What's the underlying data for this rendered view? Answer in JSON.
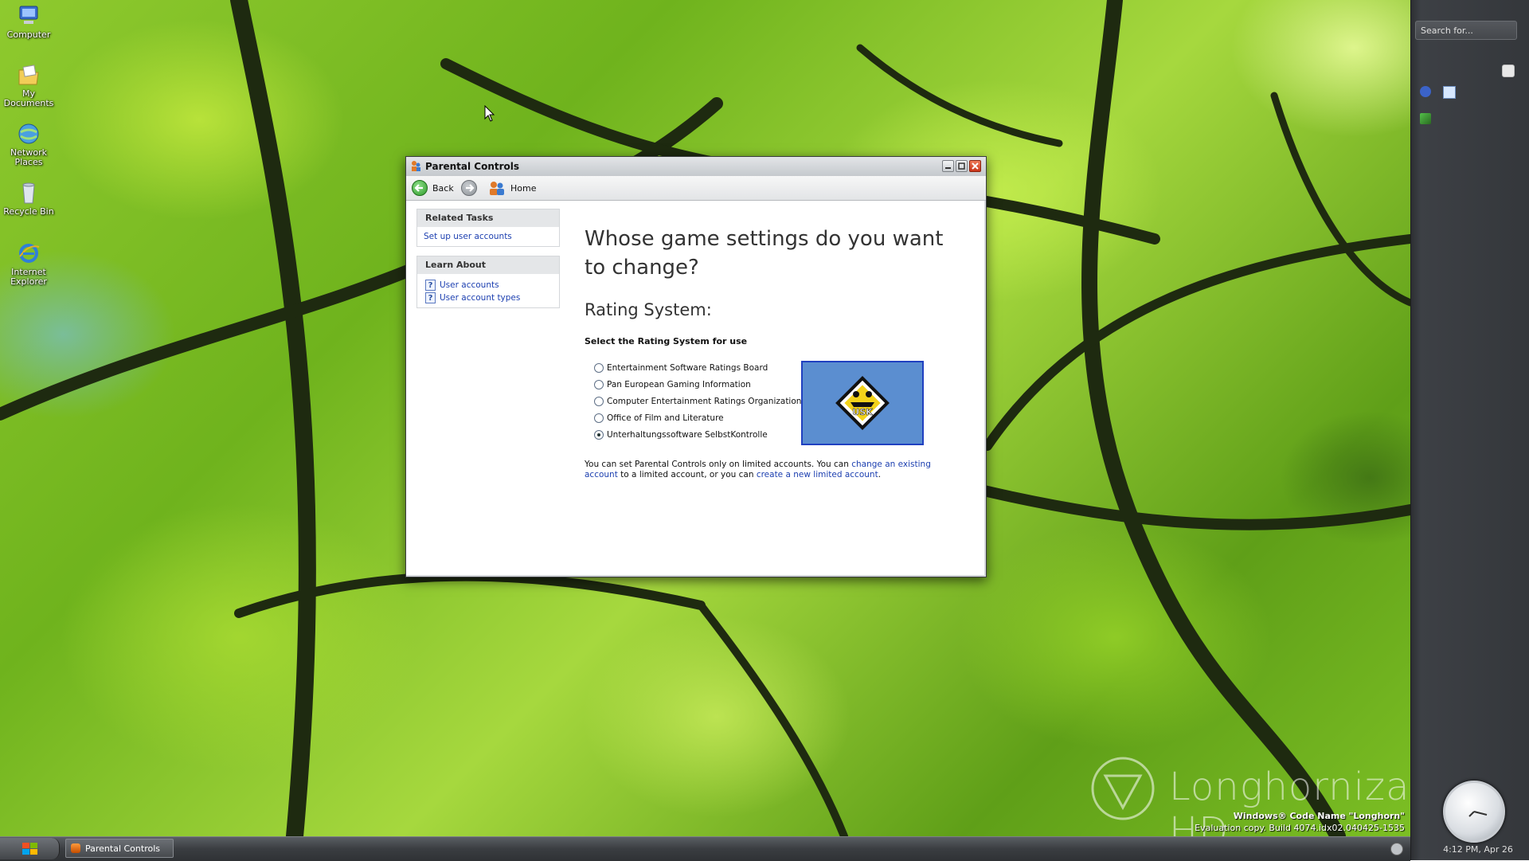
{
  "desktop": {
    "icons": [
      {
        "label": "Computer",
        "icon": "computer-icon"
      },
      {
        "label": "My Documents",
        "icon": "my-documents-icon"
      },
      {
        "label": "Network Places",
        "icon": "network-places-icon"
      },
      {
        "label": "Recycle Bin",
        "icon": "recycle-bin-icon"
      },
      {
        "label": "Internet Explorer",
        "icon": "internet-explorer-icon"
      }
    ]
  },
  "sidebar": {
    "search_placeholder": "Search for...",
    "clock_text": "4:12 PM, Apr 26"
  },
  "taskbar": {
    "items": [
      {
        "label": "Parental Controls"
      }
    ]
  },
  "watermark": {
    "brand": "Longhornization HD",
    "build_line1": "Windows® Code Name \"Longhorn\"",
    "build_line2": "Evaluation copy. Build 4074.idx02.040425-1535"
  },
  "window": {
    "title": "Parental Controls",
    "toolbar": {
      "back_label": "Back",
      "home_label": "Home"
    },
    "related_tasks": {
      "heading": "Related Tasks",
      "links": [
        "Set up user accounts"
      ]
    },
    "learn_about": {
      "heading": "Learn About",
      "links": [
        "User accounts",
        "User account types"
      ]
    },
    "main": {
      "heading": "Whose game settings do you want to change?",
      "subheading": "Rating System:",
      "select_label": "Select the Rating System for use",
      "options": [
        {
          "label": "Entertainment Software Ratings Board",
          "checked": false
        },
        {
          "label": "Pan European Gaming Information",
          "checked": false
        },
        {
          "label": "Computer Entertainment Ratings Organization",
          "checked": false
        },
        {
          "label": "Office of Film and Literature",
          "checked": false
        },
        {
          "label": "Unterhaltungssoftware SelbstKontrolle",
          "checked": true
        }
      ],
      "rating_logo_text": "USK",
      "footnote": {
        "part1": "You can set Parental Controls only on limited accounts. You can ",
        "link1": "change an existing account",
        "part2": " to a limited account, or you can ",
        "link2": "create a new limited account",
        "part3": "."
      }
    }
  },
  "colors": {
    "link": "#1c3fb0",
    "rating_box_bg": "#5b8ed0",
    "rating_box_border": "#2040c0"
  }
}
